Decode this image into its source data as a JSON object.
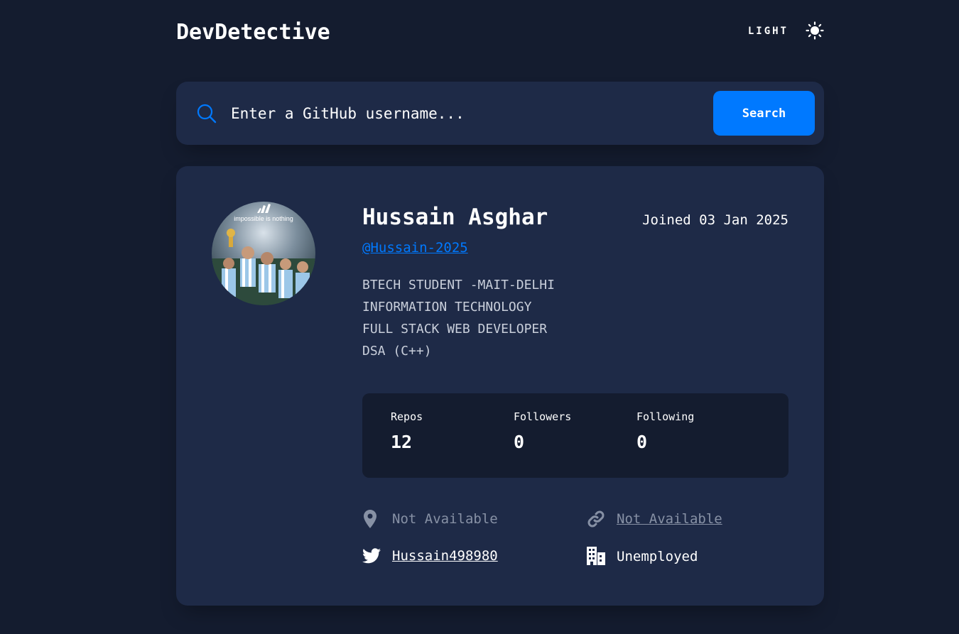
{
  "header": {
    "logo": "DevDetective",
    "mode_label": "LIGHT",
    "mode_icon": "sun-icon"
  },
  "search": {
    "placeholder": "Enter a GitHub username...",
    "button_label": "Search",
    "icon": "search-icon"
  },
  "profile": {
    "name": "Hussain Asghar",
    "joined": "Joined 03 Jan 2025",
    "login": "@Hussain-2025",
    "bio_lines": [
      "BTECH STUDENT -MAIT-DELHI",
      "INFORMATION TECHNOLOGY",
      "FULL STACK WEB DEVELOPER",
      "DSA (C++)"
    ],
    "avatar_text": "impossible is nothing",
    "stats": [
      {
        "label": "Repos",
        "value": "12"
      },
      {
        "label": "Followers",
        "value": "0"
      },
      {
        "label": "Following",
        "value": "0"
      }
    ],
    "links": {
      "location": {
        "icon": "location-pin-icon",
        "text": "Not Available"
      },
      "website": {
        "icon": "link-icon",
        "text": "Not Available"
      },
      "twitter": {
        "icon": "twitter-icon",
        "text": "Hussain498980"
      },
      "company": {
        "icon": "building-icon",
        "text": "Unemployed"
      }
    }
  },
  "colors": {
    "background": "#141c2f",
    "card": "#1e2a47",
    "accent": "#0079ff",
    "muted": "#8791a5"
  }
}
